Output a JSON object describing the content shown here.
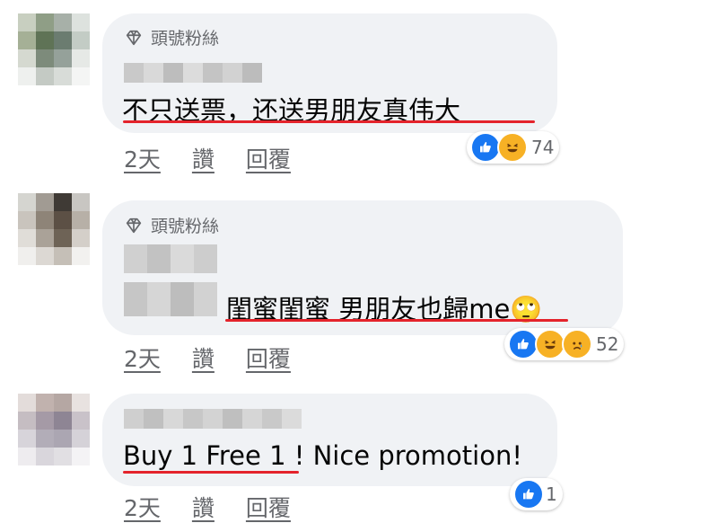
{
  "comments": [
    {
      "badge": "頭號粉絲",
      "text": "不只送票，还送男朋友真伟大",
      "time": "2天",
      "like": "讚",
      "reply": "回覆",
      "reaction_count": "74",
      "reactions": [
        "like-icon",
        "haha-icon"
      ]
    },
    {
      "badge": "頭號粉絲",
      "text": "閨蜜閨蜜 男朋友也歸me🙄",
      "time": "2天",
      "like": "讚",
      "reply": "回覆",
      "reaction_count": "52",
      "reactions": [
        "like-icon",
        "haha-icon",
        "sad-icon"
      ]
    },
    {
      "text": "Buy 1 Free 1 ! Nice promotion!",
      "time": "2天",
      "like": "讚",
      "reply": "回覆",
      "reaction_count": "1",
      "reactions": [
        "like-icon"
      ]
    }
  ],
  "colors": {
    "bubble": "#f0f2f5",
    "underline": "#e4232b",
    "like_blue": "#1877f2",
    "meta_gray": "#65676b"
  }
}
